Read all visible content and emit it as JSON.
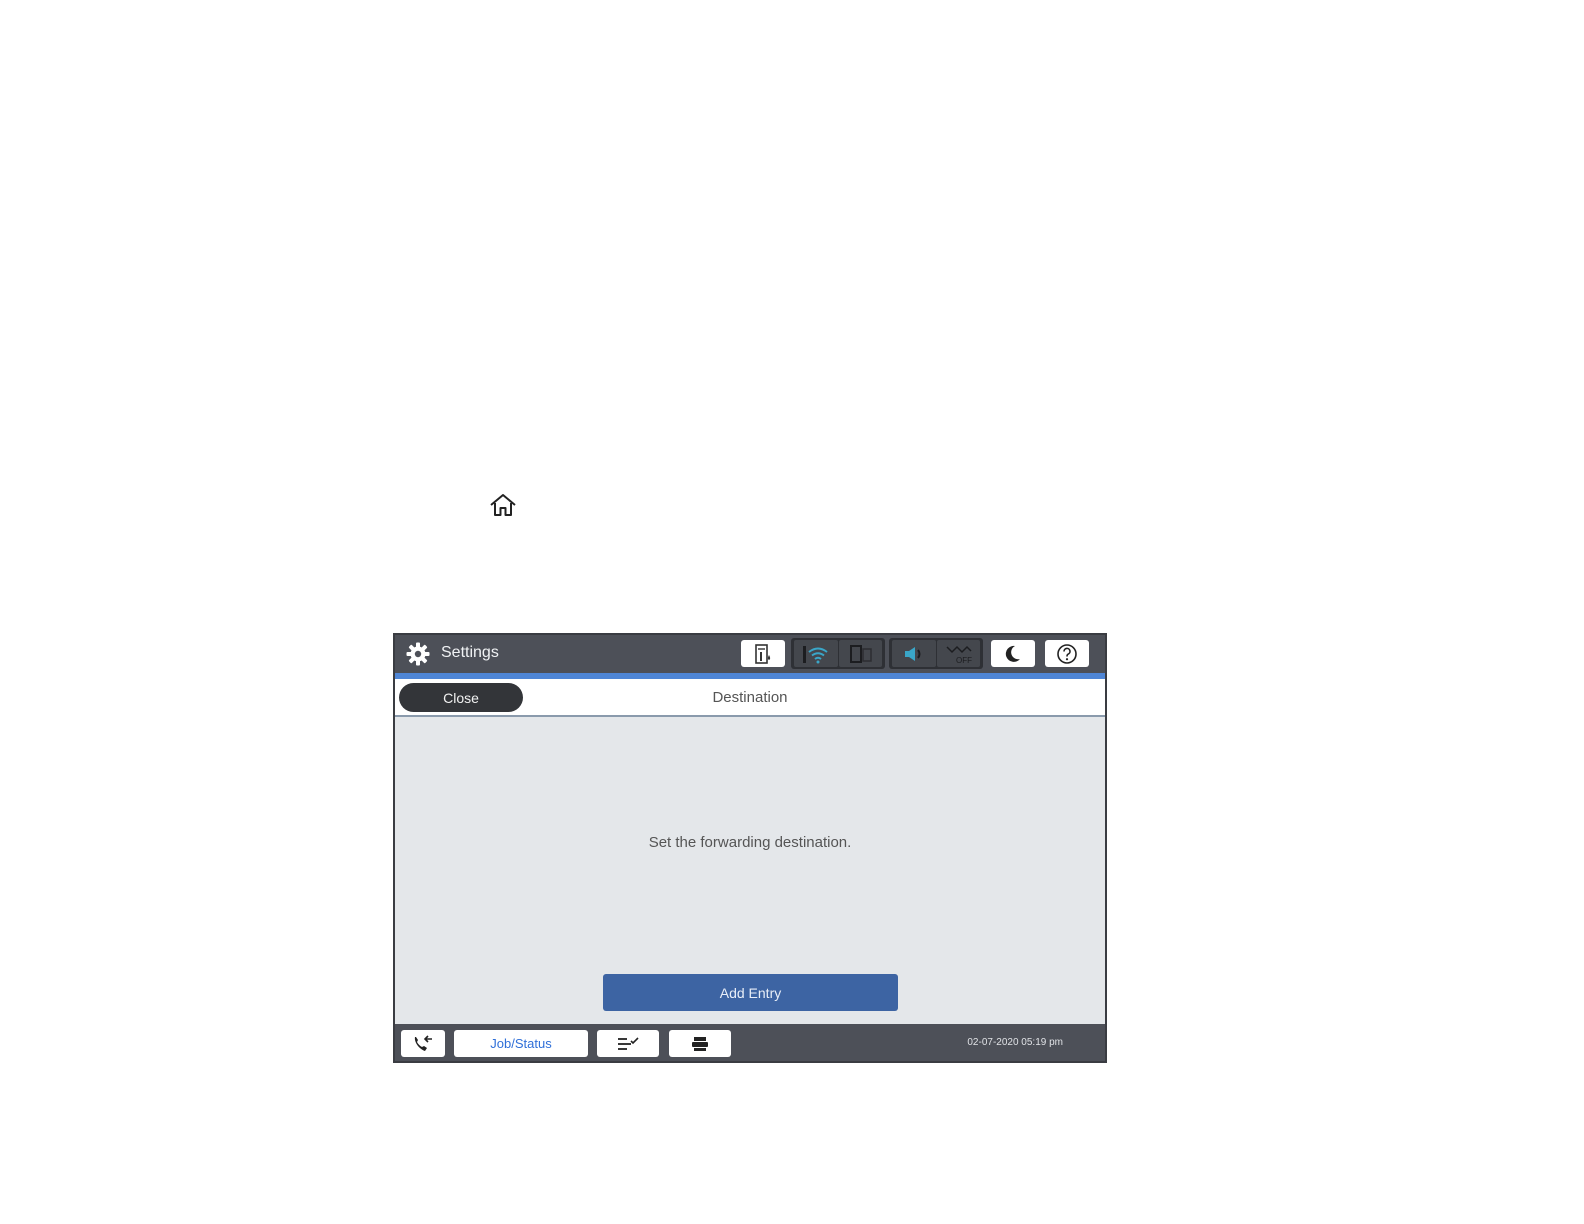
{
  "header": {
    "title": "Settings"
  },
  "subheader": {
    "close_label": "Close",
    "title": "Destination"
  },
  "main": {
    "message": "Set the forwarding destination.",
    "add_entry_label": "Add Entry"
  },
  "status_icons": [
    "ink-icon",
    "wifi-icon",
    "wifi-direct-icon",
    "speaker-icon",
    "mute-off-icon",
    "moon-icon",
    "help-icon"
  ],
  "bottom": {
    "job_status_label": "Job/Status",
    "datetime": "02-07-2020 05:19 pm",
    "icons": [
      "fax-receive-icon",
      "job-list-icon",
      "printer-icon"
    ]
  },
  "colors": {
    "topbar": "#4d5058",
    "accent_strip": "#4f86d6",
    "add_entry_button": "#3d64a3",
    "job_status_text": "#2f6fd8"
  }
}
